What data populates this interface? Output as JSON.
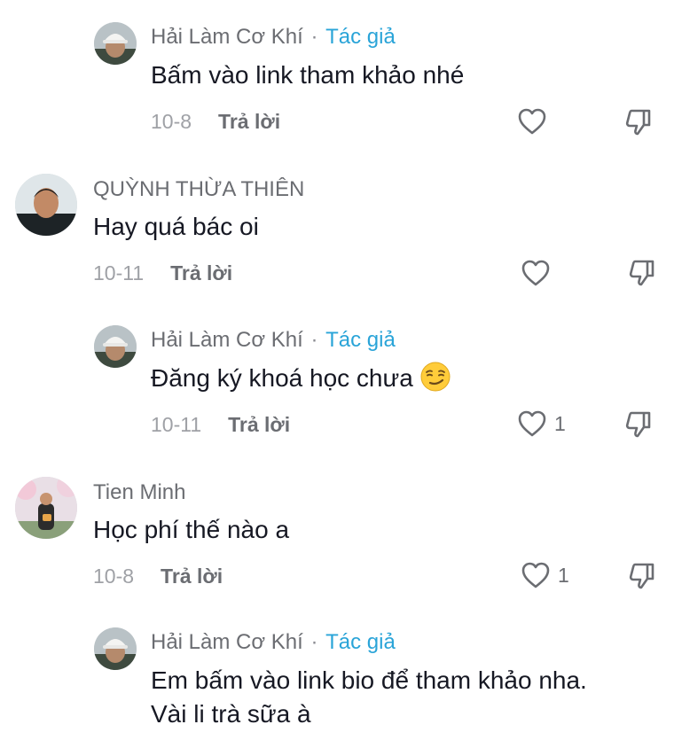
{
  "badge_label": "Tác giả",
  "reply_label": "Trả lời",
  "accent_color": "#2aa4d8",
  "comments": [
    {
      "author": "Hải Làm Cơ Khí",
      "is_author": true,
      "text": "Bấm vào link tham khảo nhé",
      "date": "10-8",
      "likes": ""
    },
    {
      "author": "QUỲNH THỪA THIÊN",
      "is_author": false,
      "text": "Hay quá bác oi",
      "date": "10-11",
      "likes": ""
    },
    {
      "author": "Hải Làm Cơ Khí",
      "is_author": true,
      "text": "Đăng ký khoá học chưa",
      "emoji": "smirk-emoji",
      "date": "10-11",
      "likes": "1"
    },
    {
      "author": "Tien Minh",
      "is_author": false,
      "text": "Học phí thế nào a",
      "date": "10-8",
      "likes": "1"
    },
    {
      "author": "Hải Làm Cơ Khí",
      "is_author": true,
      "text_lines": [
        "Em bấm vào link bio để tham khảo nha.",
        "Vài li trà sữa à"
      ]
    }
  ]
}
